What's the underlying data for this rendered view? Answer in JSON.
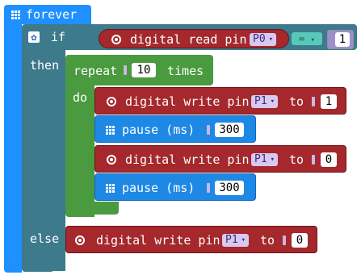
{
  "forever": {
    "label": "forever"
  },
  "if_block": {
    "if_label": "if",
    "then_label": "then",
    "else_label": "else"
  },
  "condition": {
    "read_label": "digital read pin",
    "pin": "P0",
    "operator": "=",
    "value": "1"
  },
  "repeat_block": {
    "label": "repeat",
    "count": "10",
    "times_label": "times",
    "do_label": "do"
  },
  "then_body": [
    {
      "label": "digital write pin",
      "pin": "P1",
      "to_label": "to",
      "value": "1"
    },
    {
      "label": "pause (ms)",
      "value": "300"
    },
    {
      "label": "digital write pin",
      "pin": "P1",
      "to_label": "to",
      "value": "0"
    },
    {
      "label": "pause (ms)",
      "value": "300"
    }
  ],
  "else_body": {
    "label": "digital write pin",
    "pin": "P1",
    "to_label": "to",
    "value": "0"
  },
  "colors": {
    "forever": "#1e90ff",
    "if": "#3d7a8c",
    "repeat": "#4a9a3f",
    "pins": "#a4282c",
    "pause": "#1e88e5"
  }
}
